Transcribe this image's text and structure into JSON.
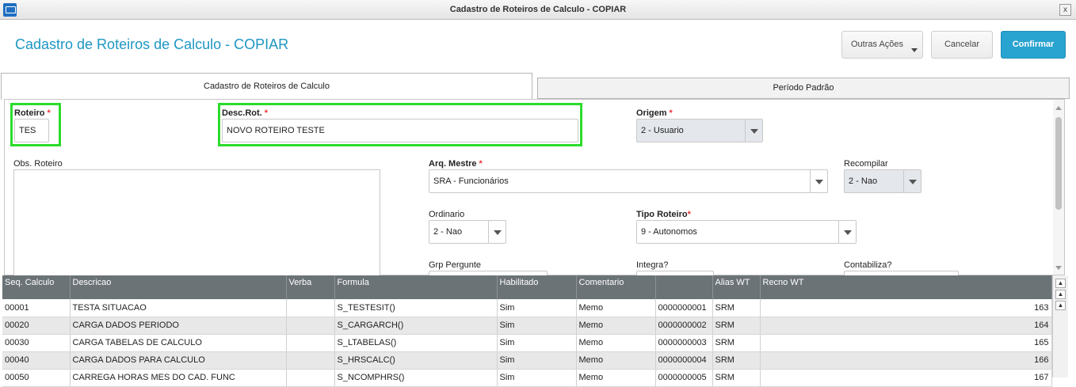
{
  "window": {
    "title": "Cadastro de Roteiros de Calculo - COPIAR",
    "close_label": "x"
  },
  "header": {
    "title": "Cadastro de Roteiros de Calculo - COPIAR",
    "other_actions_label": "Outras Ações",
    "cancel_label": "Cancelar",
    "confirm_label": "Confirmar"
  },
  "tabs": [
    {
      "label": "Cadastro de Roteiros de Calculo",
      "active": true
    },
    {
      "label": "Período Padrão",
      "active": false
    }
  ],
  "form": {
    "roteiro": {
      "label": "Roteiro",
      "value": "TES"
    },
    "desc_rot": {
      "label": "Desc.Rot.",
      "value": "NOVO ROTEIRO TESTE"
    },
    "origem": {
      "label": "Origem",
      "value": "2 - Usuario"
    },
    "obs_roteiro": {
      "label": "Obs. Roteiro",
      "value": ""
    },
    "arq_mestre": {
      "label": "Arq. Mestre",
      "value": "SRA - Funcionários"
    },
    "recompilar": {
      "label": "Recompilar",
      "value": "2 - Nao"
    },
    "ordinario": {
      "label": "Ordinario",
      "value": "2 - Nao"
    },
    "tipo_roteiro": {
      "label": "Tipo Roteiro",
      "value": "9 - Autonomos"
    },
    "grp_pergunte": {
      "label": "Grp Pergunte"
    },
    "integra": {
      "label": "Integra?"
    },
    "contabiliza": {
      "label": "Contabiliza?"
    },
    "required_mark": "*"
  },
  "grid": {
    "columns": [
      "Seq. Calculo",
      "Descricao",
      "Verba",
      "Formula",
      "Habilitado",
      "Comentario",
      "",
      "Alias WT",
      "Recno WT"
    ],
    "rows": [
      [
        "00001",
        "TESTA SITUACAO",
        "",
        "S_TESTESIT()",
        "Sim",
        "Memo",
        "0000000001",
        "SRM",
        "163"
      ],
      [
        "00020",
        "CARGA DADOS PERIODO",
        "",
        "S_CARGARCH()",
        "Sim",
        "Memo",
        "0000000002",
        "SRM",
        "164"
      ],
      [
        "00030",
        "CARGA TABELAS DE CALCULO",
        "",
        "S_LTABELAS()",
        "Sim",
        "Memo",
        "0000000003",
        "SRM",
        "165"
      ],
      [
        "00040",
        "CARGA DADOS PARA CALCULO",
        "",
        "S_HRSCALC()",
        "Sim",
        "Memo",
        "0000000004",
        "SRM",
        "166"
      ],
      [
        "00050",
        "CARREGA HORAS MES DO CAD. FUNC",
        "",
        "S_NCOMPHRS()",
        "Sim",
        "Memo",
        "0000000005",
        "SRM",
        "167"
      ]
    ]
  },
  "colors": {
    "accent": "#1e97c3",
    "confirm": "#29a3cf",
    "highlight": "#2cdc2c",
    "grid_header": "#6b7377"
  }
}
